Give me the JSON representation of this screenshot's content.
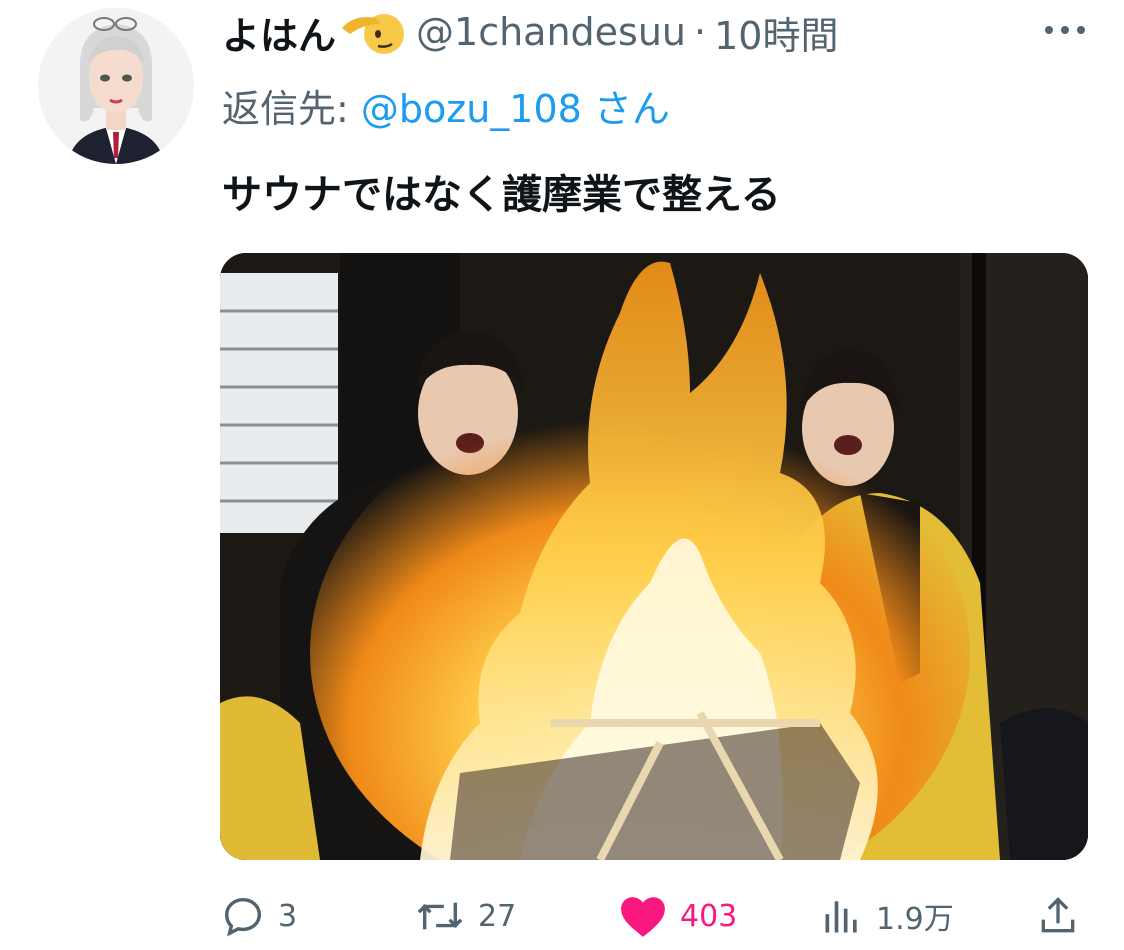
{
  "tweet": {
    "display_name": "よはん",
    "name_emoji": "saluting-face-emoji",
    "handle": "@1chandesuu",
    "separator": "·",
    "timestamp": "10時間",
    "reply_prefix": "返信先: ",
    "reply_to": "@bozu_108 さん",
    "text": "サウナではなく護摩業で整える",
    "image_description_icon": "photo-of-two-monks-beside-fire"
  },
  "actions": {
    "replies": "3",
    "retweets": "27",
    "likes": "403",
    "views": "1.9万"
  },
  "colors": {
    "text_primary": "#0f1419",
    "text_secondary": "#536471",
    "link": "#1d9bf0",
    "like": "#f91880"
  }
}
